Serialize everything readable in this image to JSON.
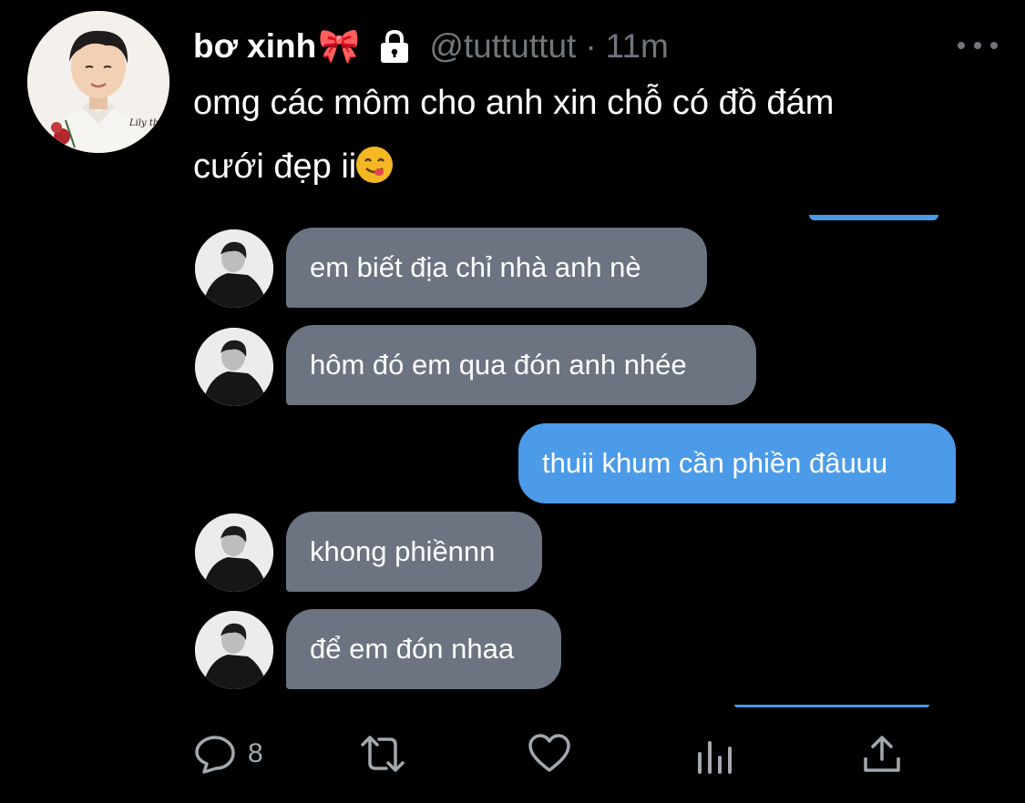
{
  "tweet": {
    "display_name": "bơ xinh",
    "name_emoji": "🎀",
    "handle": "@tuttuttut",
    "separator": "·",
    "time": "11m",
    "text_line1": "omg các môm cho anh xin chỗ có đồ đám",
    "text_line2": "cưới đẹp ii",
    "avatar_shirt_text": "Lily the"
  },
  "chat": {
    "messages": [
      {
        "side": "in",
        "text": "em biết địa chỉ nhà anh nè"
      },
      {
        "side": "in",
        "text": "hôm đó em qua đón anh nhée"
      },
      {
        "side": "out",
        "text": "thuii khum cần phiền đâuuu"
      },
      {
        "side": "in",
        "text": "khong phiềnnn"
      },
      {
        "side": "in",
        "text": "để em đón nhaa"
      }
    ]
  },
  "actions": {
    "reply_count": "8"
  },
  "colors": {
    "background": "#000000",
    "incoming_bubble": "#6b7480",
    "outgoing_bubble": "#4c9be8",
    "muted_text": "#71767b"
  },
  "icons": [
    "lock-icon",
    "more-icon",
    "reply-icon",
    "retweet-icon",
    "like-icon",
    "analytics-icon",
    "share-icon",
    "yum-emoji-icon"
  ]
}
